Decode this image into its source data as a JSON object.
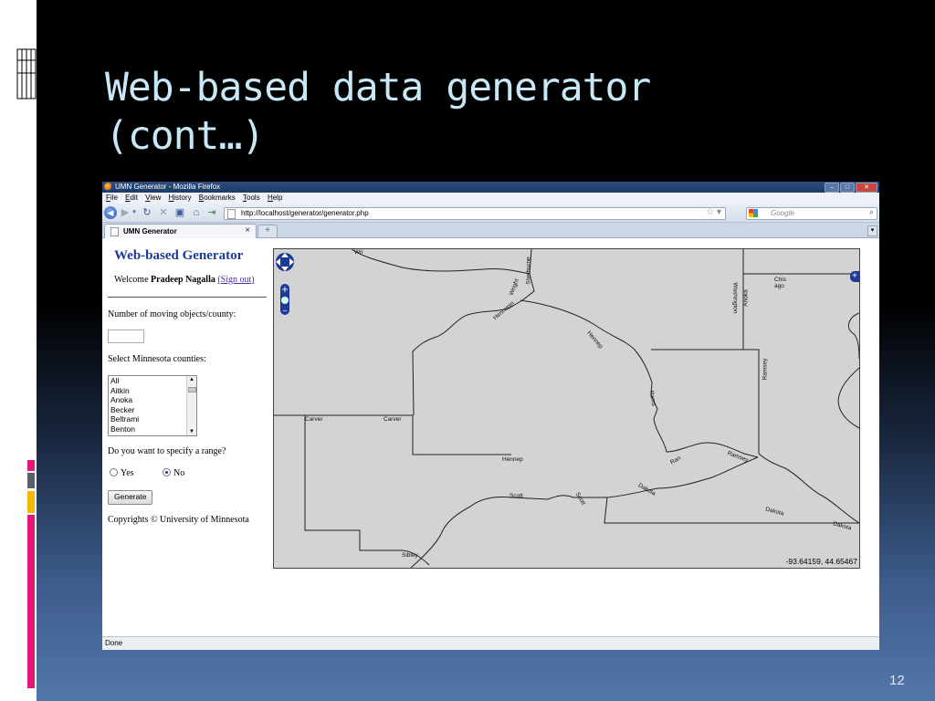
{
  "slide": {
    "title_line1": "Web-based data generator",
    "title_line2": "(cont…)",
    "number": "12"
  },
  "browser": {
    "window_title": "UMN Generator - Mozilla Firefox",
    "menu": [
      "File",
      "Edit",
      "View",
      "History",
      "Bookmarks",
      "Tools",
      "Help"
    ],
    "url": "http://localhost/generator/generator.php",
    "search_placeholder": "Google",
    "tab_title": "UMN Generator",
    "status": "Done"
  },
  "page": {
    "heading": "Web-based Generator",
    "welcome_prefix": "Welcome",
    "user_name": "Pradeep Nagalla",
    "sign_out": "(Sign out)",
    "num_objects_label": "Number of moving objects/county:",
    "num_objects_value": "",
    "counties_label": "Select Minnesota counties:",
    "counties": [
      "All",
      "Aitkin",
      "Anoka",
      "Becker",
      "Beltrami",
      "Benton"
    ],
    "range_label": "Do you want to specify a range?",
    "range_options": [
      "Yes",
      "No"
    ],
    "range_selected": "No",
    "generate_button": "Generate",
    "copyright": "Copyrights © University of Minnesota"
  },
  "map": {
    "coordinates": "-93.64159, 44.65467",
    "labels": {
      "sherburne": "Sherburne",
      "wright": "Wright",
      "hennepin_top": "Hennepin",
      "hennepin_mid": "Hennep",
      "washington": "Washington",
      "anoka": "Anoka",
      "chisago": "Chis ago",
      "ramsey": "Ramsey",
      "ramsey_river": "Ramsey",
      "carver_1": "Carver",
      "carver_2": "Carver",
      "rams": "Rams",
      "scott": "Scott",
      "dakota_1": "Dakota",
      "dakota_2": "Dakota",
      "dakota_3": "Dakota",
      "sibley": "Sibley",
      "scott_2": "Scott",
      "ran": "Ran",
      "wright_top": "Wri"
    }
  }
}
